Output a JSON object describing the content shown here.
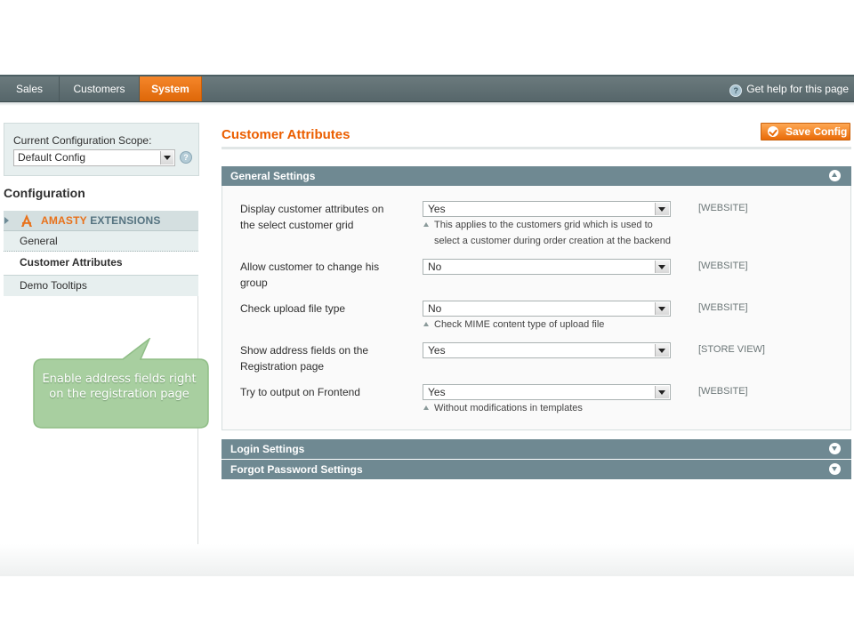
{
  "nav": {
    "items": [
      {
        "label": "Sales",
        "active": false
      },
      {
        "label": "Customers",
        "active": false
      },
      {
        "label": "System",
        "active": true
      }
    ],
    "help_label": "Get help for this page"
  },
  "sidebar": {
    "scope_label": "Current Configuration Scope:",
    "scope_value": "Default Config",
    "config_title": "Configuration",
    "group_brand": "AMASTY",
    "group_suffix": "EXTENSIONS",
    "items": [
      {
        "label": "General",
        "selected": false
      },
      {
        "label": "Customer Attributes",
        "selected": true
      },
      {
        "label": "Demo Tooltips",
        "selected": false
      }
    ]
  },
  "callout": {
    "text": "Enable address fields right on the registration page"
  },
  "main": {
    "title": "Customer Attributes",
    "save_label": "Save Config",
    "sections": [
      {
        "label": "General Settings",
        "expanded": true
      },
      {
        "label": "Login Settings",
        "expanded": false
      },
      {
        "label": "Forgot Password Settings",
        "expanded": false
      }
    ],
    "fields": [
      {
        "label": "Display customer attributes on the select customer grid",
        "value": "Yes",
        "note_line1": "This applies to the customers grid which is used to",
        "note_line2": "select a customer during order creation at the backend",
        "scope": "[WEBSITE]"
      },
      {
        "label": "Allow customer to change his group",
        "value": "No",
        "note_line1": "",
        "note_line2": "",
        "scope": "[WEBSITE]"
      },
      {
        "label": "Check upload file type",
        "value": "No",
        "note_line1": "Check MIME content type of upload file",
        "note_line2": "",
        "scope": "[WEBSITE]"
      },
      {
        "label": "Show address fields on the Registration page",
        "value": "Yes",
        "note_line1": "",
        "note_line2": "",
        "scope": "[STORE VIEW]"
      },
      {
        "label": "Try to output on Frontend",
        "value": "Yes",
        "note_line1": "Without modifications in templates",
        "note_line2": "",
        "scope": "[WEBSITE]"
      }
    ]
  },
  "colors": {
    "accent_orange": "#eb5e00",
    "nav_active": "#f5862a",
    "section_header": "#6f8992",
    "callout_green": "#a8cfa0"
  }
}
